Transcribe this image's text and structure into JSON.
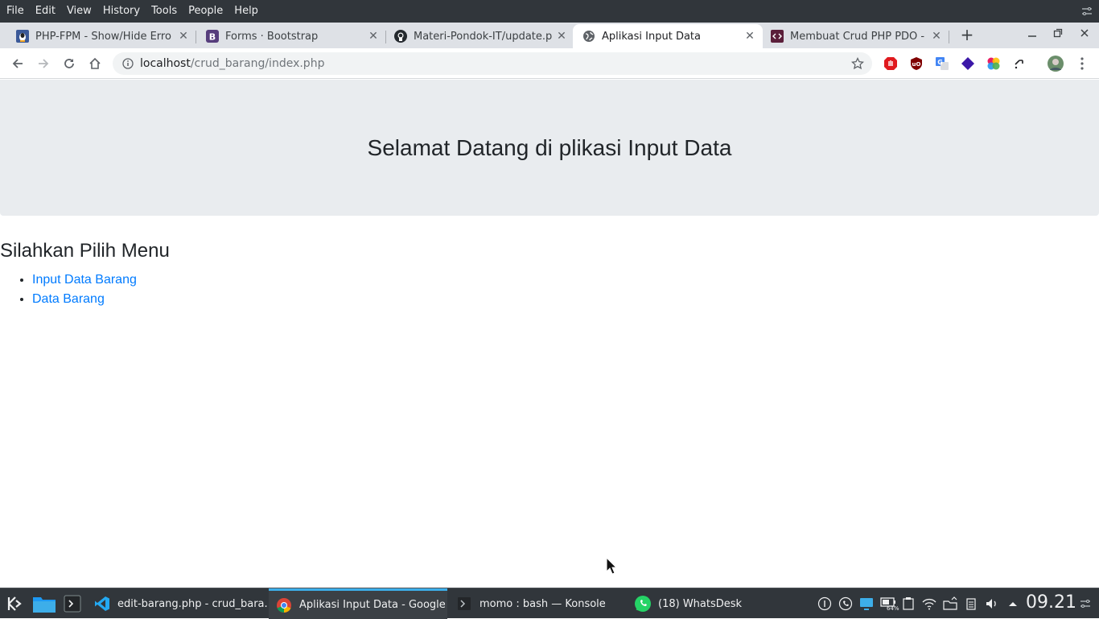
{
  "menubar": {
    "items": [
      "File",
      "Edit",
      "View",
      "History",
      "Tools",
      "People",
      "Help"
    ]
  },
  "tabs": [
    {
      "title": "PHP-FPM - Show/Hide Erro",
      "icon": "linux-penguin-icon",
      "active": false
    },
    {
      "title": "Forms · Bootstrap",
      "icon": "bootstrap-icon",
      "active": false
    },
    {
      "title": "Materi-Pondok-IT/update.p",
      "icon": "github-icon",
      "active": false
    },
    {
      "title": "Aplikasi Input Data",
      "icon": "globe-icon",
      "active": true
    },
    {
      "title": "Membuat Crud PHP PDO -",
      "icon": "code-site-icon",
      "active": false
    }
  ],
  "address": {
    "host": "localhost",
    "path": "/crud_barang/index.php"
  },
  "page": {
    "jumbotron_title": "Selamat Datang di plikasi Input Data",
    "menu_heading": "Silahkan Pilih Menu",
    "links": [
      "Input Data Barang",
      "Data Barang"
    ]
  },
  "colors": {
    "link": "#007bff",
    "jumbotron_bg": "#e9ecef",
    "taskbar_bg": "#31363b",
    "active_task_accent": "#3daee9"
  },
  "taskbar": {
    "tasks": [
      {
        "label": "edit-barang.php - crud_bara...",
        "icon": "vscode-icon"
      },
      {
        "label": "Aplikasi Input Data - Google ...",
        "icon": "chrome-icon"
      },
      {
        "label": "momo : bash — Konsole",
        "icon": "terminal-icon"
      },
      {
        "label": "(18) WhatsDesk",
        "icon": "whatsapp-icon"
      }
    ],
    "battery": "64%",
    "clock": "09.21"
  }
}
